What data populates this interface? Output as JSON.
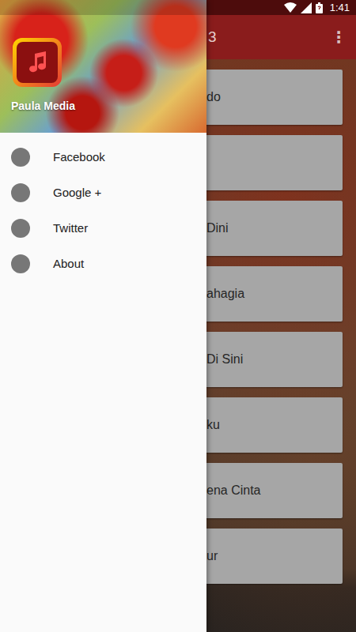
{
  "status_bar": {
    "time": "1:41"
  },
  "app_bar": {
    "title": "3",
    "menu_icon": "⋮"
  },
  "list": {
    "items": [
      {
        "title": "do"
      },
      {
        "title": ""
      },
      {
        "title": "Dini"
      },
      {
        "title": "ahagia"
      },
      {
        "title": "Di Sini"
      },
      {
        "title": "ku"
      },
      {
        "title": "ena Cinta"
      },
      {
        "title": "ur"
      }
    ]
  },
  "drawer": {
    "header": {
      "title": "Paula Media"
    },
    "items": [
      {
        "label": "Facebook"
      },
      {
        "label": "Google +"
      },
      {
        "label": "Twitter"
      },
      {
        "label": "About"
      }
    ]
  }
}
